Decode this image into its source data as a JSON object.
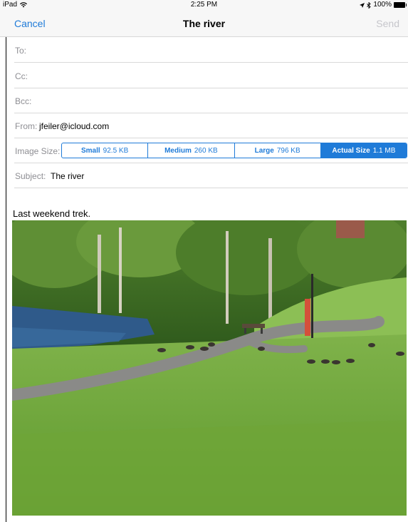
{
  "status_bar": {
    "device": "iPad",
    "time": "2:25 PM",
    "battery": "100%"
  },
  "nav": {
    "cancel_label": "Cancel",
    "title": "The river",
    "send_label": "Send"
  },
  "fields": {
    "to_label": "To:",
    "cc_label": "Cc:",
    "bcc_label": "Bcc:",
    "from_label": "From:",
    "from_value": "jfeiler@icloud.com",
    "image_size_label": "Image Size:",
    "subject_label": "Subject:",
    "subject_value": "The river"
  },
  "image_size_options": [
    {
      "name": "Small",
      "size": "92.5 KB"
    },
    {
      "name": "Medium",
      "size": "260 KB"
    },
    {
      "name": "Large",
      "size": "796 KB"
    },
    {
      "name": "Actual Size",
      "size": "1.1 MB"
    }
  ],
  "image_size_selected": "Actual Size",
  "message": {
    "body": "Last weekend trek."
  },
  "colors": {
    "accent": "#1f7bd8",
    "send_disabled": "#c6c6cb",
    "label_gray": "#8e8e93"
  },
  "icons": [
    "wifi-icon",
    "location-icon",
    "bluetooth-icon",
    "battery-icon"
  ]
}
